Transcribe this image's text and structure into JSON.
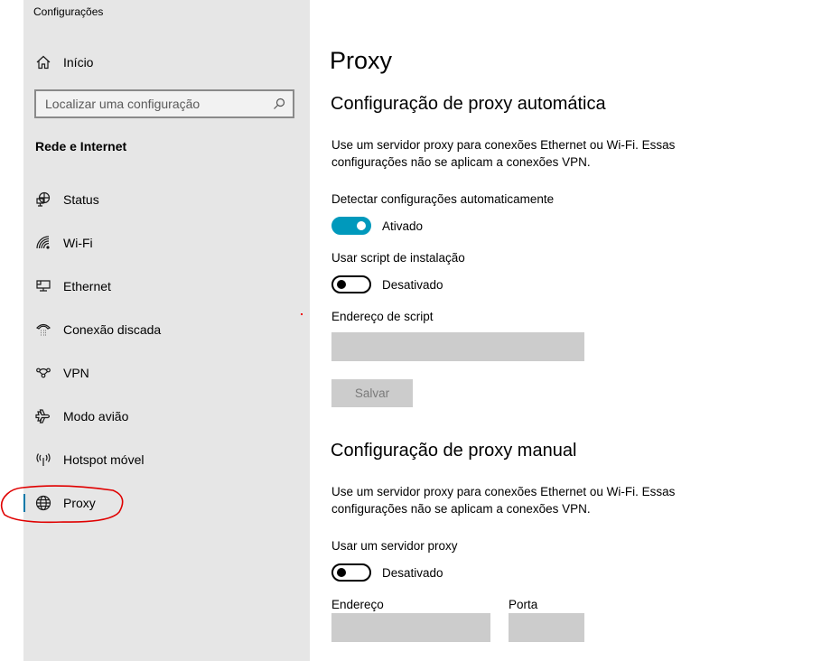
{
  "window": {
    "title": "Configurações"
  },
  "sidebar": {
    "home": {
      "label": "Início",
      "icon": "home-icon"
    },
    "search": {
      "placeholder": "Localizar uma configuração",
      "value": "",
      "icon": "search-icon"
    },
    "section_title": "Rede e Internet",
    "items": [
      {
        "label": "Status",
        "icon": "network-status-icon",
        "active": false
      },
      {
        "label": "Wi-Fi",
        "icon": "wifi-icon",
        "active": false
      },
      {
        "label": "Ethernet",
        "icon": "ethernet-icon",
        "active": false
      },
      {
        "label": "Conexão discada",
        "icon": "dialup-phone-icon",
        "active": false
      },
      {
        "label": "VPN",
        "icon": "vpn-icon",
        "active": false
      },
      {
        "label": "Modo avião",
        "icon": "airplane-icon",
        "active": false
      },
      {
        "label": "Hotspot móvel",
        "icon": "hotspot-icon",
        "active": false
      },
      {
        "label": "Proxy",
        "icon": "globe-icon",
        "active": true
      }
    ],
    "accent_color": "#0078a8"
  },
  "main": {
    "page_title": "Proxy",
    "auto": {
      "heading": "Configuração de proxy automática",
      "description": "Use um servidor proxy para conexões Ethernet ou Wi-Fi. Essas configurações não se aplicam a conexões VPN.",
      "detect": {
        "label": "Detectar configurações automaticamente",
        "state": true,
        "state_text": "Ativado"
      },
      "script": {
        "label": "Usar script de instalação",
        "state": false,
        "state_text": "Desativado"
      },
      "script_address": {
        "label": "Endereço de script",
        "value": ""
      },
      "save_label": "Salvar"
    },
    "manual": {
      "heading": "Configuração de proxy manual",
      "description": "Use um servidor proxy para conexões Ethernet ou Wi-Fi. Essas configurações não se aplicam a conexões VPN.",
      "use_proxy": {
        "label": "Usar um servidor proxy",
        "state": false,
        "state_text": "Desativado"
      },
      "address": {
        "label": "Endereço",
        "value": ""
      },
      "port": {
        "label": "Porta",
        "value": ""
      }
    },
    "toggle_on_color": "#0099bc"
  },
  "annotation": {
    "color": "#e00000",
    "highlights": "Proxy"
  }
}
